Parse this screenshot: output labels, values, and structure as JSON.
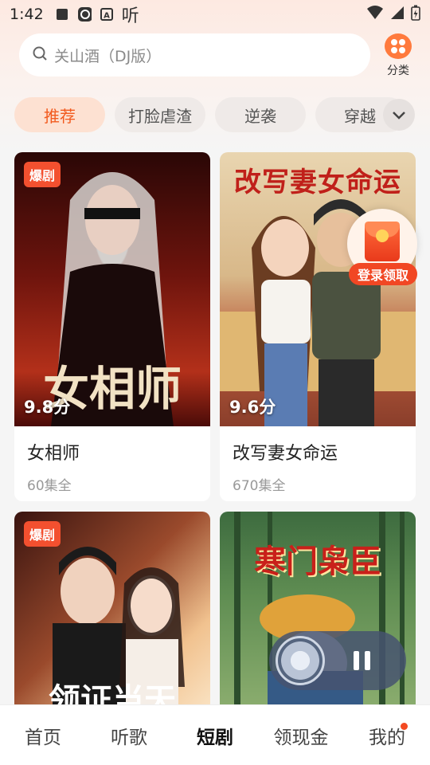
{
  "status_bar": {
    "time": "1:42",
    "listen_label": "听"
  },
  "search": {
    "placeholder_text": "关山酒（DJ版）"
  },
  "category_button": {
    "label": "分类"
  },
  "tabs": [
    {
      "label": "推荐",
      "active": true
    },
    {
      "label": "打脸虐渣",
      "active": false
    },
    {
      "label": "逆袭",
      "active": false
    },
    {
      "label": "穿越",
      "active": false
    }
  ],
  "cards": [
    {
      "badge": "爆剧",
      "rating": "9.8分",
      "title": "女相师",
      "episodes": "60集全",
      "poster_text": "女相师",
      "poster_colors": [
        "#3b0b09",
        "#8a1c12"
      ]
    },
    {
      "badge": "",
      "rating": "9.6分",
      "title": "改写妻女命运",
      "episodes": "670集全",
      "poster_text": "改写妻女命运",
      "poster_colors": [
        "#d7c19a",
        "#b25b3a"
      ]
    },
    {
      "badge": "爆剧",
      "rating": "",
      "title": "",
      "episodes": "",
      "poster_text": "领证当天",
      "poster_colors": [
        "#8e3b2a",
        "#f0c89a"
      ]
    },
    {
      "badge": "",
      "rating": "",
      "title": "",
      "episodes": "",
      "poster_text": "寒门枭臣",
      "poster_colors": [
        "#2f5a36",
        "#6e9a58"
      ]
    }
  ],
  "promo": {
    "label": "登录领取"
  },
  "player": {
    "state": "playing"
  },
  "bottom_nav": [
    {
      "label": "首页",
      "active": false
    },
    {
      "label": "听歌",
      "active": false
    },
    {
      "label": "短剧",
      "active": true
    },
    {
      "label": "领现金",
      "active": false
    },
    {
      "label": "我的",
      "active": false,
      "has_dot": true
    }
  ],
  "colors": {
    "accent": "#f25a1e",
    "badge": "#f3502f",
    "tab_active_bg": "#fde1d2"
  }
}
